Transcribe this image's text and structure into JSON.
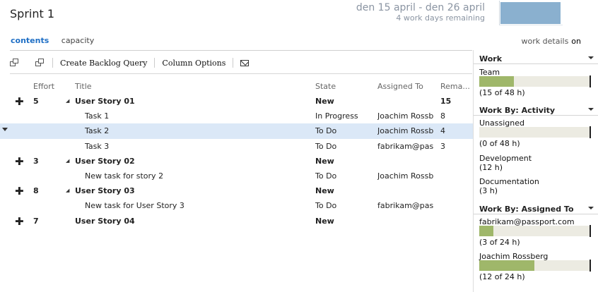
{
  "header": {
    "title": "Sprint 1",
    "dates": "den 15 april - den 26 april",
    "remaining": "4 work days remaining"
  },
  "view_tabs": [
    "contents",
    "capacity"
  ],
  "work_details": {
    "label": "work details",
    "state": "on"
  },
  "toolbar": {
    "create_query": "Create Backlog Query",
    "column_options": "Column Options"
  },
  "grid": {
    "columns": {
      "effort": "Effort",
      "title": "Title",
      "state": "State",
      "assigned": "Assigned To",
      "remaining": "Rema..."
    },
    "rows": [
      {
        "type": "story",
        "effort": "5",
        "title": "User Story 01",
        "state": "New",
        "assigned": "",
        "remaining": "15"
      },
      {
        "type": "task",
        "effort": "",
        "title": "Task 1",
        "state": "In Progress",
        "assigned": "Joachim Rossb...",
        "remaining": "8"
      },
      {
        "type": "task",
        "effort": "",
        "title": "Task 2",
        "state": "To Do",
        "assigned": "Joachim Rossb...",
        "remaining": "4",
        "selected": true
      },
      {
        "type": "task",
        "effort": "",
        "title": "Task 3",
        "state": "To Do",
        "assigned": "fabrikam@pas...",
        "remaining": "3"
      },
      {
        "type": "story",
        "effort": "3",
        "title": "User Story 02",
        "state": "New",
        "assigned": "",
        "remaining": ""
      },
      {
        "type": "task",
        "effort": "",
        "title": "New task for story 2",
        "state": "To Do",
        "assigned": "Joachim Rossb...",
        "remaining": ""
      },
      {
        "type": "story",
        "effort": "8",
        "title": "User Story 03",
        "state": "New",
        "assigned": "",
        "remaining": ""
      },
      {
        "type": "task",
        "effort": "",
        "title": "New task for User Story 3",
        "state": "To Do",
        "assigned": "fabrikam@pas...",
        "remaining": ""
      },
      {
        "type": "story",
        "effort": "7",
        "title": "User Story 04",
        "state": "New",
        "assigned": "",
        "remaining": ""
      }
    ]
  },
  "panel": {
    "work": {
      "title": "Work",
      "items": [
        {
          "label": "Team",
          "detail": "(15 of 48 h)",
          "fraction": 0.3125
        }
      ]
    },
    "by_activity": {
      "title": "Work By: Activity",
      "items": [
        {
          "label": "Unassigned",
          "detail": "(0 of 48 h)",
          "fraction": 0
        },
        {
          "label": "Development",
          "detail": "(12 h)"
        },
        {
          "label": "Documentation",
          "detail": "(3 h)"
        }
      ]
    },
    "by_assigned": {
      "title": "Work By: Assigned To",
      "items": [
        {
          "label": "fabrikam@passport.com",
          "detail": "(3 of 24 h)",
          "fraction": 0.125
        },
        {
          "label": "Joachim Rossberg",
          "detail": "(12 of 24 h)",
          "fraction": 0.5
        }
      ]
    }
  },
  "colors": {
    "accent": "#1f6fc5",
    "bar_fill": "#9fb76a",
    "bar_track": "#ecebe2",
    "selected_row": "#dbe8f7",
    "burndown": "#8ab0cf"
  }
}
